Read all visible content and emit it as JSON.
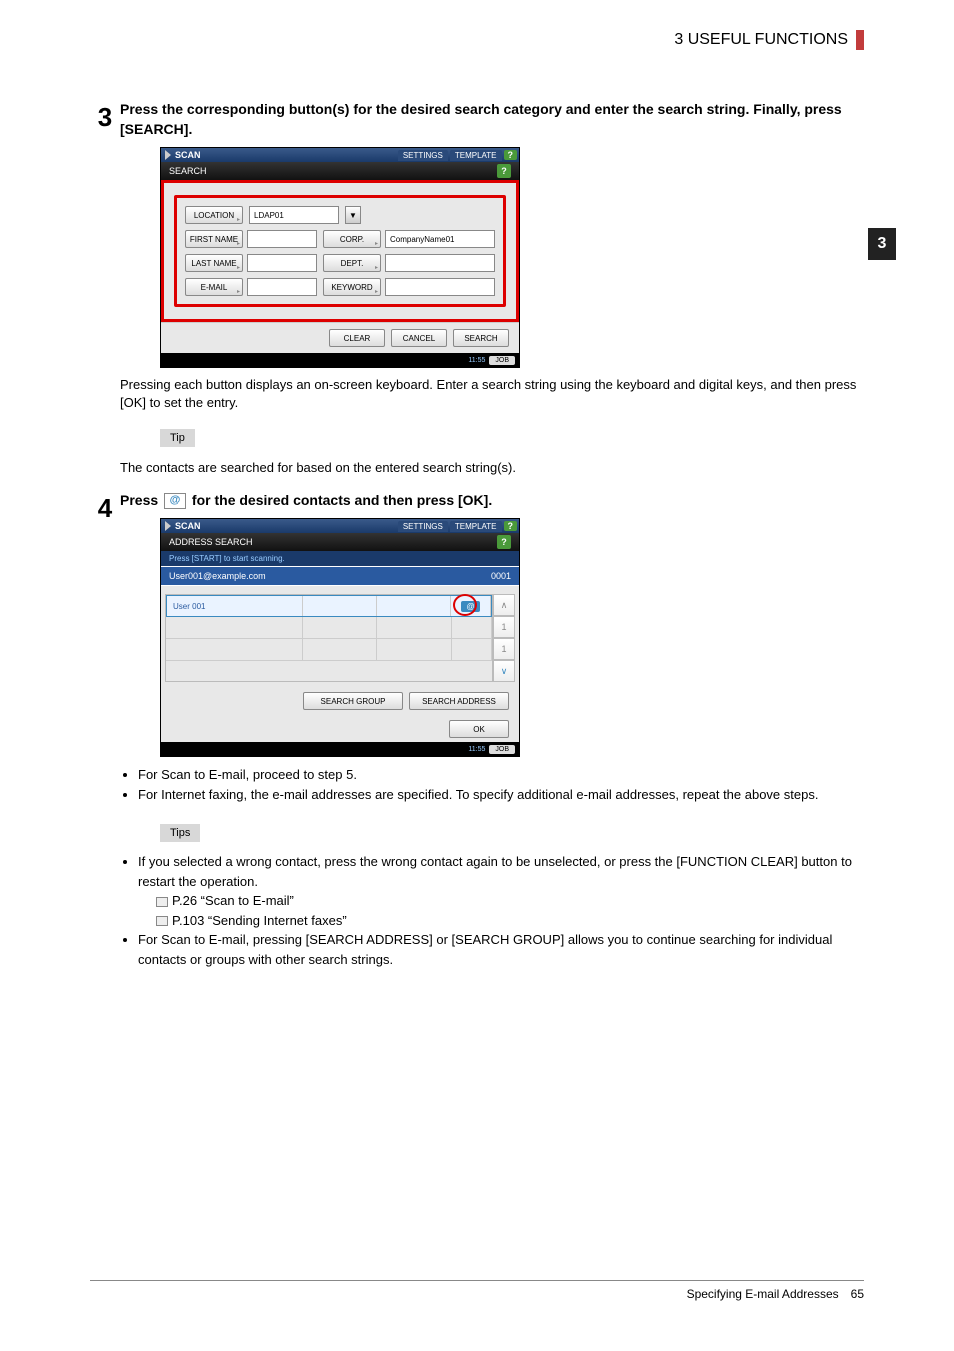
{
  "header": {
    "chapter_title": "3 USEFUL FUNCTIONS"
  },
  "side_tab": "3",
  "step3": {
    "num": "3",
    "heading": "Press the corresponding button(s) for the desired search category and enter the search string. Finally, press [SEARCH].",
    "caption": "Pressing each button displays an on-screen keyboard. Enter a search string using the keyboard and digital keys, and then press [OK] to set the entry.",
    "tip_label": "Tip",
    "tip_text": "The contacts are searched for based on the entered search string(s)."
  },
  "step4": {
    "num": "4",
    "heading_pre": "Press ",
    "heading_at": "@",
    "heading_post": " for the desired contacts and then press [OK].",
    "bullet1": "For Scan to E-mail, proceed to step 5.",
    "bullet2": "For Internet faxing, the e-mail addresses are specified. To specify additional e-mail addresses, repeat the above steps.",
    "tips_label": "Tips",
    "tip_bullet1": "If you selected a wrong contact, press the wrong contact again to be unselected, or press the [FUNCTION CLEAR] button to restart the operation.",
    "ref1": "P.26 “Scan to E-mail”",
    "ref2": "P.103 “Sending Internet faxes”",
    "tip_bullet2": "For Scan to E-mail, pressing [SEARCH ADDRESS] or [SEARCH GROUP] allows you to continue searching for individual contacts or groups with other search strings."
  },
  "ss1": {
    "scan": "SCAN",
    "settings": "SETTINGS",
    "template": "TEMPLATE",
    "help": "?",
    "title": "SEARCH",
    "location_label": "LOCATION",
    "location_value": "LDAP01",
    "first_name": "FIRST NAME",
    "last_name": "LAST NAME",
    "email": "E-MAIL",
    "corp": "CORP.",
    "corp_value": "CompanyName01",
    "dept": "DEPT.",
    "keyword": "KEYWORD",
    "clear": "CLEAR",
    "cancel": "CANCEL",
    "search": "SEARCH",
    "time": "11:55",
    "job": "JOB"
  },
  "ss2": {
    "scan": "SCAN",
    "settings": "SETTINGS",
    "template": "TEMPLATE",
    "help": "?",
    "title": "ADDRESS SEARCH",
    "hint": "Press [START] to start scanning.",
    "email": "User001@example.com",
    "count": "0001",
    "user": "User 001",
    "at": "@",
    "page1": "1",
    "page2": "1",
    "search_group": "SEARCH GROUP",
    "search_address": "SEARCH ADDRESS",
    "ok": "OK",
    "time": "11:55",
    "job": "JOB"
  },
  "footer": {
    "title": "Specifying E-mail Addresses",
    "page": "65"
  }
}
